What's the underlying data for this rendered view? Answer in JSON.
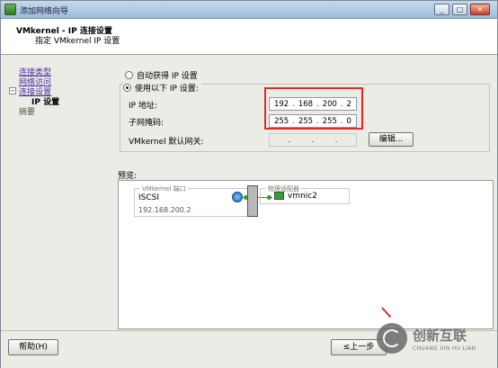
{
  "window": {
    "title": "添加网络向导",
    "min_glyph": "_",
    "max_glyph": "□",
    "close_glyph": "✕"
  },
  "header": {
    "title": "VMkernel - IP 连接设置",
    "subtitle": "指定 VMkernel IP 设置"
  },
  "nav": {
    "items": [
      {
        "label": "连接类型",
        "state": "link"
      },
      {
        "label": "网络访问",
        "state": "link"
      },
      {
        "label": "连接设置",
        "state": "link"
      },
      {
        "label": "IP 设置",
        "state": "current"
      },
      {
        "label": "摘要",
        "state": "plain"
      }
    ],
    "toggle_glyph": "−"
  },
  "settings": {
    "auto_option": "自动获得 IP 设置",
    "manual_option": "使用以下 IP 设置:",
    "selected": "manual",
    "ip_label": "IP 地址:",
    "ip_octets": [
      "192",
      "168",
      "200",
      "2"
    ],
    "mask_label": "子网掩码:",
    "mask_octets": [
      "255",
      "255",
      "255",
      "0"
    ],
    "gateway_label": "VMkernel 默认网关:",
    "gateway_octets": [
      "",
      "",
      "",
      ""
    ],
    "edit_button": "编辑...",
    "dot": "."
  },
  "preview": {
    "label": "预览:",
    "vmkernel_legend": "VMkernel 端口",
    "port_name": "ISCSI",
    "port_ip": "192.168.200.2",
    "adapter_legend": "物理适配器",
    "nic_name": "vmnic2"
  },
  "footer": {
    "help_button": "帮助(H)",
    "back_button": "≤上一步"
  },
  "watermark": {
    "text_cn": "创新互联",
    "text_en": "CHUANG XIN HU LIAN"
  },
  "colors": {
    "highlight": "#e02a2a",
    "link": "#4a2d9f",
    "connector": "#2d9b2d"
  }
}
